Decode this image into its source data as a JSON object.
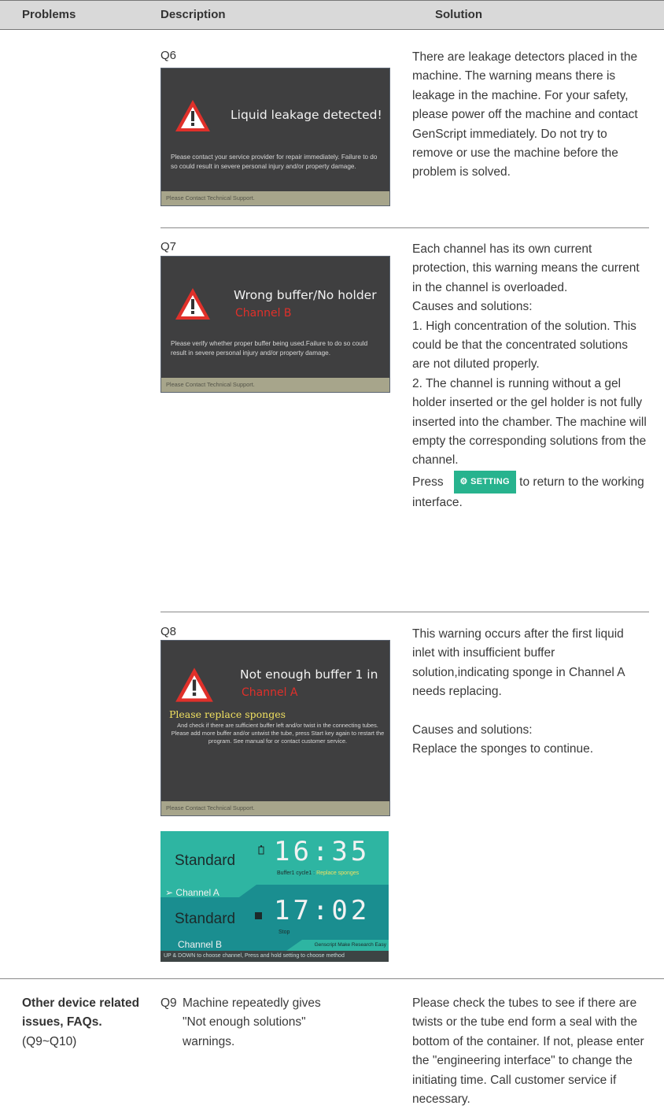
{
  "header": {
    "problems": "Problems",
    "description": "Description",
    "solution": "Solution"
  },
  "q6": {
    "label": "Q6",
    "screen": {
      "title": "Liquid leakage detected!",
      "body": "Please contact your service provider for repair immediately. Failure to do so could result in severe personal injury and/or property damage.",
      "footer": "Please Contact Technical Support."
    },
    "solution": "There are leakage detectors placed in the machine. The warning means there is leakage in the machine. For your safety, please power off the machine and contact GenScript immediately. Do not try to remove or use the machine before the problem is solved."
  },
  "q7": {
    "label": "Q7",
    "screen": {
      "title": "Wrong buffer/No holder",
      "channel": "Channel B",
      "body": "Please verify whether proper buffer being used.Failure to do so could result in severe personal injury and/or property damage.",
      "footer": "Please Contact Technical Support."
    },
    "solution": {
      "p1": "Each channel has its own current protection, this warning means the current in the channel is overloaded.",
      "p2": "Causes and solutions:",
      "p3": "1. High concentration of the solution. This could be that the concentrated solutions are not diluted properly.",
      "p4": "2. The channel is running without a gel holder inserted or the gel holder is not fully inserted into the chamber. The machine will empty the corresponding solutions from the channel.",
      "press": "Press",
      "setting_button": "SETTING",
      "after": "to return to the working interface."
    }
  },
  "q8": {
    "label": "Q8",
    "screen": {
      "title": "Not enough buffer 1 in",
      "channel": "Channel A",
      "sponge": "Please replace sponges",
      "body": "And  check if there are sufficient buffer left and/or twist  in the connecting tubes. Please add more buffer and/or untwist the tube, press Start key again to restart the program. See manual for or contact customer service.",
      "footer": "Please Contact Technical Support."
    },
    "run_screen": {
      "row1_mode": "Standard",
      "row1_time": "16:35",
      "row1_status": "Buffer1 cycle1 : ",
      "row1_status_hl": "Replace sponges",
      "row1_channel": "Channel A",
      "row2_mode": "Standard",
      "row2_time": "17:02",
      "row2_status": "Stop",
      "row2_channel": "Channel B",
      "slogan": "Genscript Make Research Easy",
      "footer": "UP & DOWN to choose channel, Press and hold setting to choose method"
    },
    "solution": {
      "p1": "This warning occurs after the first liquid inlet with insufficient buffer solution,indicating sponge in Channel A needs replacing.",
      "p2": "Causes and solutions:",
      "p3": "Replace the sponges to continue."
    }
  },
  "q9": {
    "problem_title": "Other device related issues, FAQs.",
    "problem_range": "(Q9~Q10)",
    "label": "Q9",
    "description": "Machine repeatedly gives \"Not enough solutions\" warnings.",
    "solution": "Please check the tubes to see if there are twists or the tube end form a seal with the bottom of the container. If not, please enter the \"engineering interface\" to change the initiating time. Call customer service if necessary."
  }
}
